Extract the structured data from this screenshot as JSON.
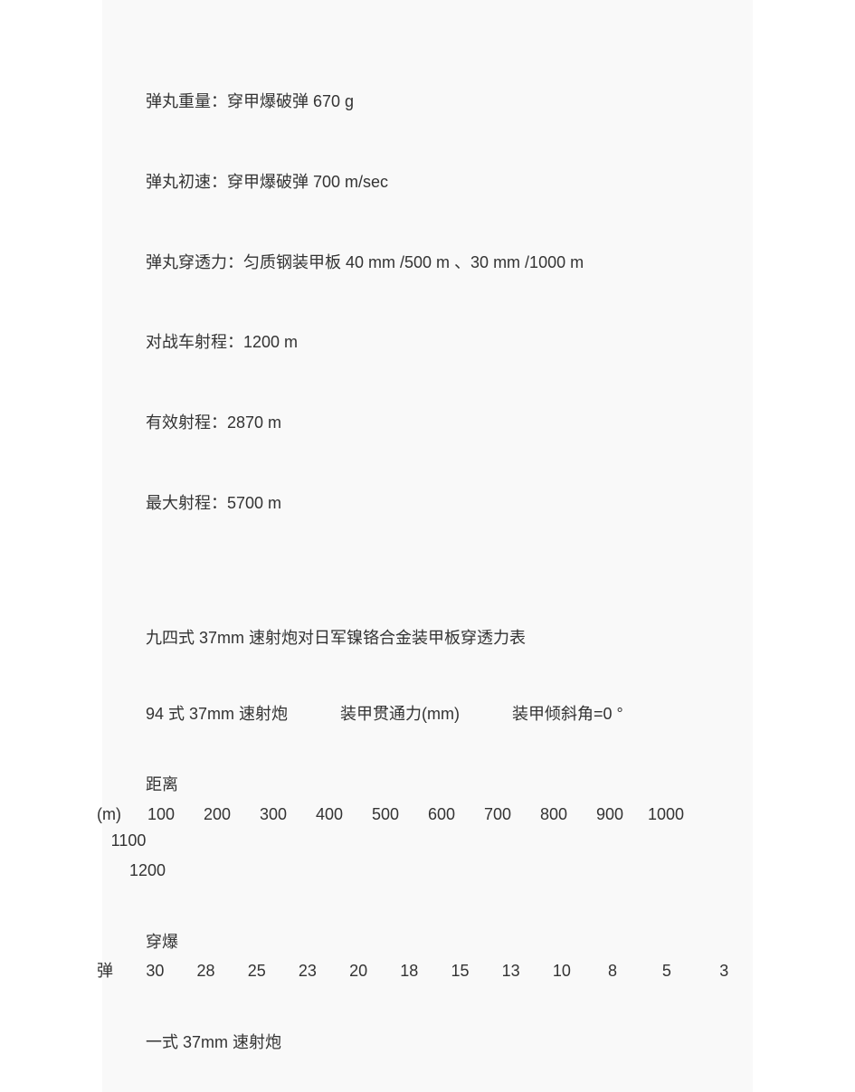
{
  "specs": {
    "weight": "弹丸重量：穿甲爆破弹 670 g",
    "muzzle": "弹丸初速：穿甲爆破弹  700 m/sec",
    "penetration": "弹丸穿透力：匀质钢装甲板  40 mm /500 m 、30 mm /1000 m",
    "anti_tank_range": "对战车射程：1200 m",
    "effective_range": "有效射程：2870 m",
    "max_range": "最大射程：5700 m"
  },
  "table_title": "九四式 37mm 速射炮对日军镍铬合金装甲板穿透力表",
  "table_header": {
    "gun": "94 式 37mm 速射炮",
    "col": "装甲贯通力(mm)",
    "angle": "装甲倾斜角=0 °"
  },
  "distance": {
    "label": "距离",
    "unit": "(m)",
    "values": [
      "100",
      "200",
      "300",
      "400",
      "500",
      "600",
      "700",
      "800",
      "900",
      "1000",
      "1100"
    ],
    "wrap": "1200"
  },
  "penetration_row": {
    "label": "穿爆",
    "unit": "弹",
    "values": [
      "30",
      "28",
      "25",
      "23",
      "20",
      "18",
      "15",
      "13",
      "10",
      "8",
      "5",
      "3"
    ]
  },
  "footer_gun": "一式 37mm 速射炮"
}
